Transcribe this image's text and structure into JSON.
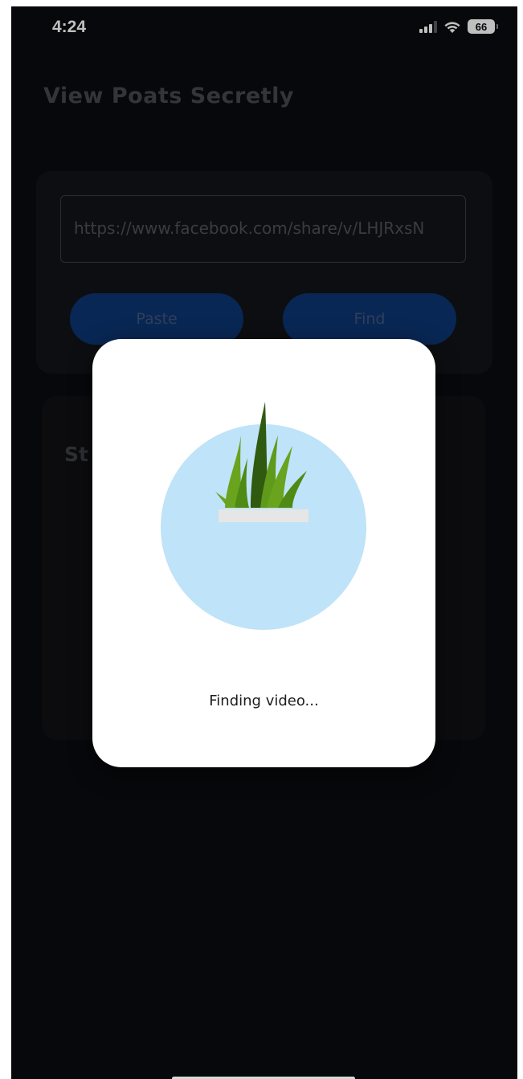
{
  "status_bar": {
    "time": "4:24",
    "battery": "66",
    "signal_icon": "cellular-signal-icon",
    "wifi_icon": "wifi-icon"
  },
  "app": {
    "title": "View Poats Secretly"
  },
  "input_card": {
    "url_value": "https://www.facebook.com/share/v/LHJRxsN",
    "paste_label": "Paste",
    "find_label": "Find"
  },
  "status_card": {
    "heading_partial": "St"
  },
  "dialog": {
    "message": "Finding video...",
    "illustration_icon": "plant-loading-icon"
  },
  "colors": {
    "background": "#0a0b0f",
    "button": "#0c3470",
    "dialog": "#ffffff",
    "illustration_circle": "#bfe3f8",
    "leaf_light": "#6aa31e",
    "leaf_dark": "#2f5a10"
  }
}
